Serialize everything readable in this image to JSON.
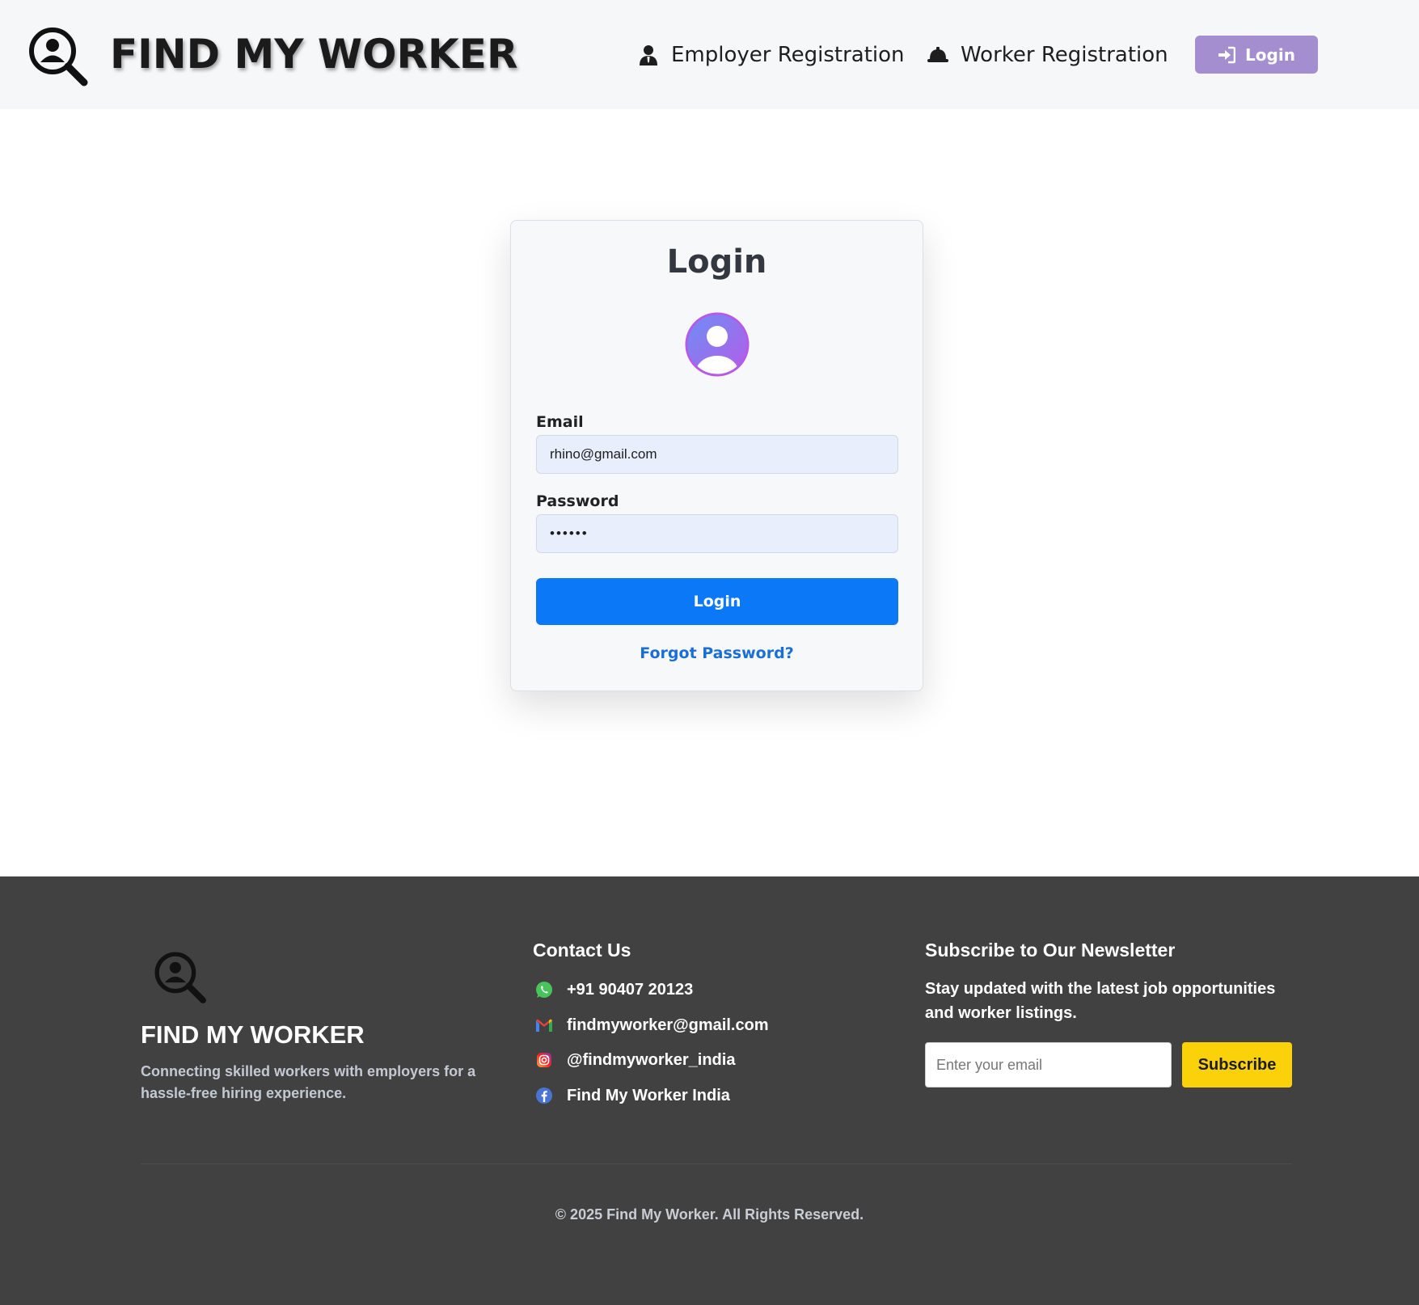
{
  "header": {
    "brand_title": "FIND MY WORKER",
    "nav": {
      "employer_registration": "Employer Registration",
      "worker_registration": "Worker Registration",
      "login": "Login"
    }
  },
  "login_card": {
    "title": "Login",
    "email_label": "Email",
    "email_value": "rhino@gmail.com",
    "password_label": "Password",
    "password_value": "••••••",
    "login_button": "Login",
    "forgot_password": "Forgot Password?"
  },
  "footer": {
    "brand": "FIND MY WORKER",
    "tagline": "Connecting skilled workers with employers for a hassle-free hiring experience.",
    "contact": {
      "title": "Contact Us",
      "items": [
        {
          "icon": "whatsapp-icon",
          "text": "+91 90407 20123"
        },
        {
          "icon": "gmail-icon",
          "text": "findmyworker@gmail.com"
        },
        {
          "icon": "instagram-icon",
          "text": "@findmyworker_india"
        },
        {
          "icon": "facebook-icon",
          "text": "Find My Worker India"
        }
      ]
    },
    "newsletter": {
      "title": "Subscribe to Our Newsletter",
      "text": "Stay updated with the latest job opportunities and worker listings.",
      "input_placeholder": "Enter your email",
      "button": "Subscribe"
    },
    "copyright": "© 2025 Find My Worker. All Rights Reserved."
  },
  "colors": {
    "header_bg": "#f6f7f9",
    "header_login_bg": "#a48ed0",
    "primary_button": "#0a78f7",
    "link": "#1a6fd6",
    "footer_bg": "#414141",
    "subscribe_bg": "#fbd10a"
  }
}
